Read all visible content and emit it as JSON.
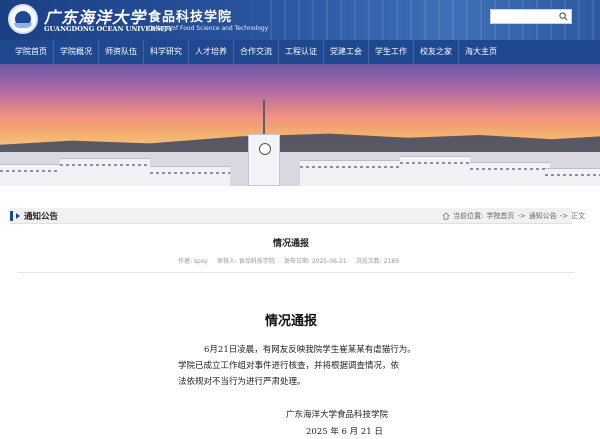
{
  "header": {
    "school_cn": "广东海洋大学",
    "college_cn": "食品科技学院",
    "school_en": "GUANGDONG OCEAN UNIVERSITY",
    "college_en": "College of Food Science and Technology",
    "search_placeholder": ""
  },
  "nav": {
    "items": [
      "学院首页",
      "学院概况",
      "师资队伍",
      "科学研究",
      "人才培养",
      "合作交流",
      "工程认证",
      "党建工会",
      "学生工作",
      "校友之家",
      "海大主页"
    ]
  },
  "section": {
    "title": "通知公告",
    "breadcrumb": {
      "prefix": "当前位置:",
      "home": "学院首页",
      "sep1": "->",
      "category": "通知公告",
      "sep2": "->",
      "current": "正文"
    }
  },
  "article": {
    "title": "情况通报",
    "meta": {
      "author": "作者: spxy",
      "reviewer": "审核人: 食品科技学院",
      "date": "发布日期: 2025-06-21",
      "views_label": "浏览次数:",
      "views": "2189"
    },
    "body": {
      "heading": "情况通报",
      "p1": "6月21日凌晨，有网友反映我院学生崔某某有虐猫行为。",
      "p2": "学院已成立工作组对事件进行核查，并将根据调查情况，依",
      "p3": "法依规对不当行为进行严肃处理。",
      "signature": "广东海洋大学食品科技学院",
      "date": "2025 年 6 月 21 日"
    }
  },
  "colors": {
    "header_blue": "#1f4891",
    "accent": "#1f4891"
  }
}
